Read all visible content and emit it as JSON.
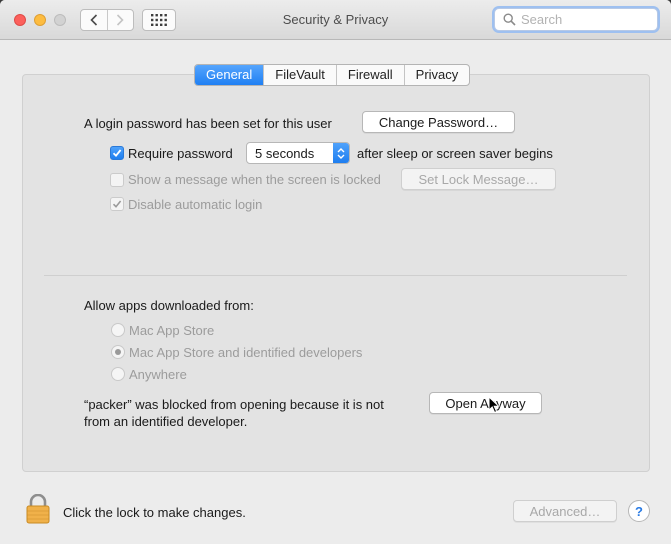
{
  "window": {
    "title": "Security & Privacy"
  },
  "toolbar": {
    "back_icon": "chevron-left-icon",
    "forward_icon": "chevron-right-icon",
    "show_all_icon": "grid-icon",
    "search": {
      "placeholder": "Search",
      "value": ""
    }
  },
  "tabs": [
    {
      "label": "General",
      "active": true
    },
    {
      "label": "FileVault",
      "active": false
    },
    {
      "label": "Firewall",
      "active": false
    },
    {
      "label": "Privacy",
      "active": false
    }
  ],
  "general": {
    "login_password_text": "A login password has been set for this user",
    "change_password_label": "Change Password…",
    "require_password": {
      "label": "Require password",
      "checked": true,
      "delay_value": "5 seconds",
      "suffix": "after sleep or screen saver begins"
    },
    "show_message": {
      "label": "Show a message when the screen is locked",
      "checked": false,
      "enabled": false,
      "button_label": "Set Lock Message…"
    },
    "disable_auto_login": {
      "label": "Disable automatic login",
      "checked": true,
      "enabled": false
    },
    "allow_apps": {
      "heading": "Allow apps downloaded from:",
      "options": [
        {
          "label": "Mac App Store",
          "selected": false
        },
        {
          "label": "Mac App Store and identified developers",
          "selected": true
        },
        {
          "label": "Anywhere",
          "selected": false
        }
      ]
    },
    "blocked": {
      "line1": "“packer” was blocked from opening because it is not",
      "line2": "from an identified developer.",
      "open_anyway_label": "Open Anyway"
    }
  },
  "footer": {
    "lock_text": "Click the lock to make changes.",
    "advanced_label": "Advanced…",
    "help_label": "?"
  },
  "colors": {
    "accent": "#1f7ff3",
    "close": "#fc605c",
    "minimize": "#fdbc40",
    "lock": "#f0b14a"
  }
}
